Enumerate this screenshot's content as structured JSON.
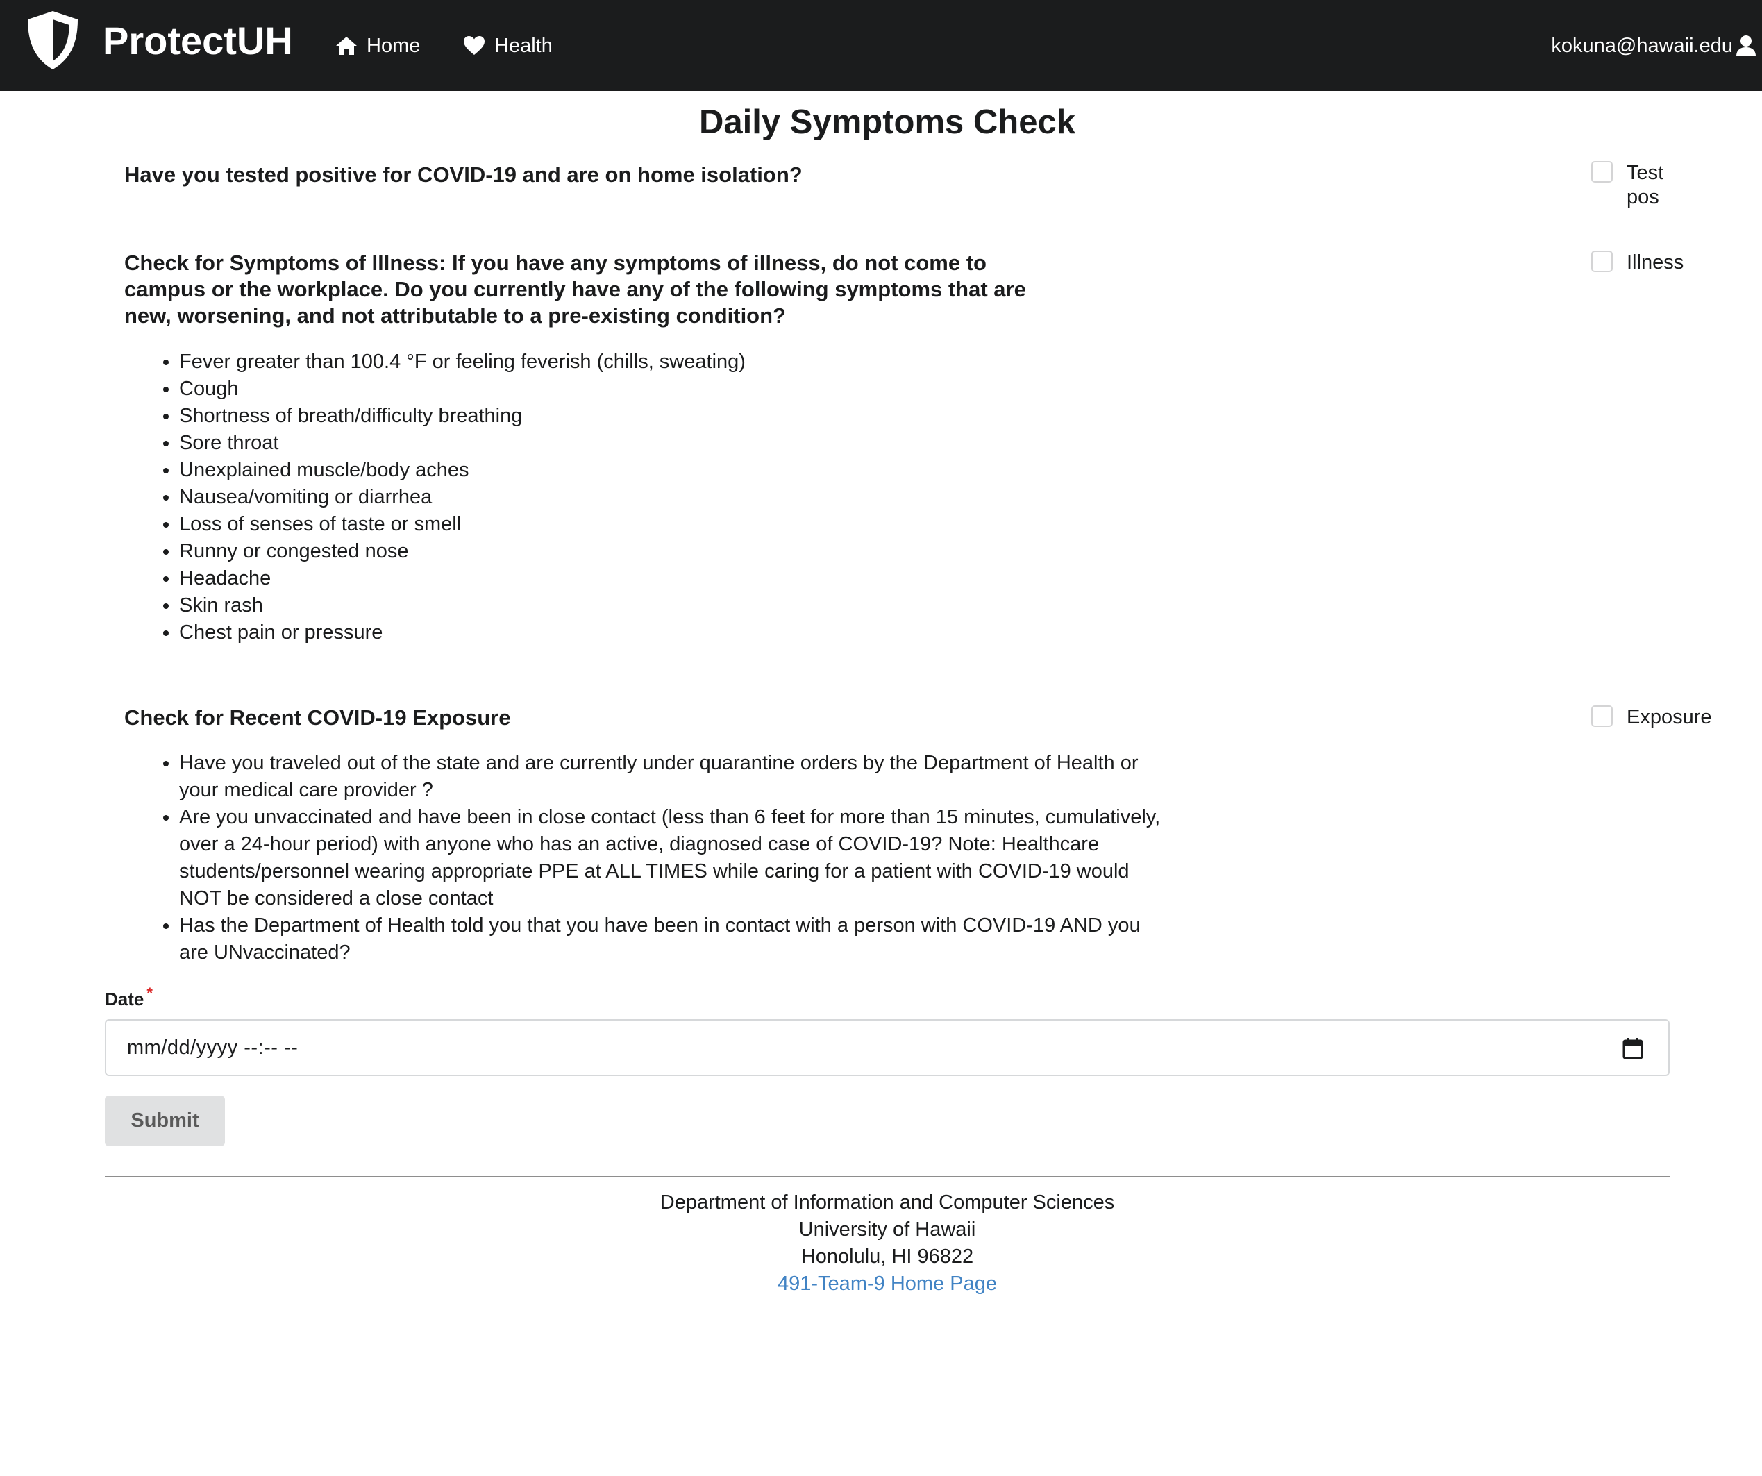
{
  "navbar": {
    "brand": "ProtectUH",
    "home_label": "Home",
    "health_label": "Health",
    "user_email": "kokuna@hawaii.edu",
    "background_color": "#1b1c1d"
  },
  "page": {
    "title": "Daily Symptoms Check"
  },
  "questions": {
    "positive": {
      "text": "Have you tested positive for COVID-19 and are on home isolation?",
      "checkbox_label": "Test pos",
      "checked": false
    },
    "illness": {
      "text": "Check for Symptoms of Illness: If you have any symptoms of illness, do not come to campus or the workplace. Do you currently have any of the following symptoms that are new, worsening, and not attributable to a pre-existing condition?",
      "checkbox_label": "Illness",
      "checked": false,
      "symptoms": [
        "Fever greater than 100.4 °F or feeling feverish (chills, sweating)",
        "Cough",
        "Shortness of breath/difficulty breathing",
        "Sore throat",
        "Unexplained muscle/body aches",
        "Nausea/vomiting or diarrhea",
        "Loss of senses of taste or smell",
        "Runny or congested nose",
        "Headache",
        "Skin rash",
        "Chest pain or pressure"
      ]
    },
    "exposure": {
      "text": "Check for Recent COVID-19 Exposure",
      "checkbox_label": "Exposure",
      "checked": false,
      "items": [
        "Have you traveled out of the state and are currently under quarantine orders by the Department of Health or your medical care provider ?",
        "Are you unvaccinated and have been in close contact (less than 6 feet for more than 15 minutes, cumulatively, over a 24-hour period) with anyone who has an active, diagnosed case of COVID-19? Note: Healthcare students/personnel wearing appropriate PPE at ALL TIMES while caring for a patient with COVID-19 would NOT be considered a close contact",
        "Has the Department of Health told you that you have been in contact with a person with COVID-19 AND you are UNvaccinated?"
      ]
    }
  },
  "date_field": {
    "label": "Date",
    "required_mark": "*",
    "placeholder": "mm/dd/yyyy --:-- --"
  },
  "submit": {
    "label": "Submit"
  },
  "footer": {
    "line1": "Department of Information and Computer Sciences",
    "line2": "University of Hawaii",
    "line3": "Honolulu, HI 96822",
    "link": "491-Team-9 Home Page",
    "link_color": "#4183c4"
  }
}
